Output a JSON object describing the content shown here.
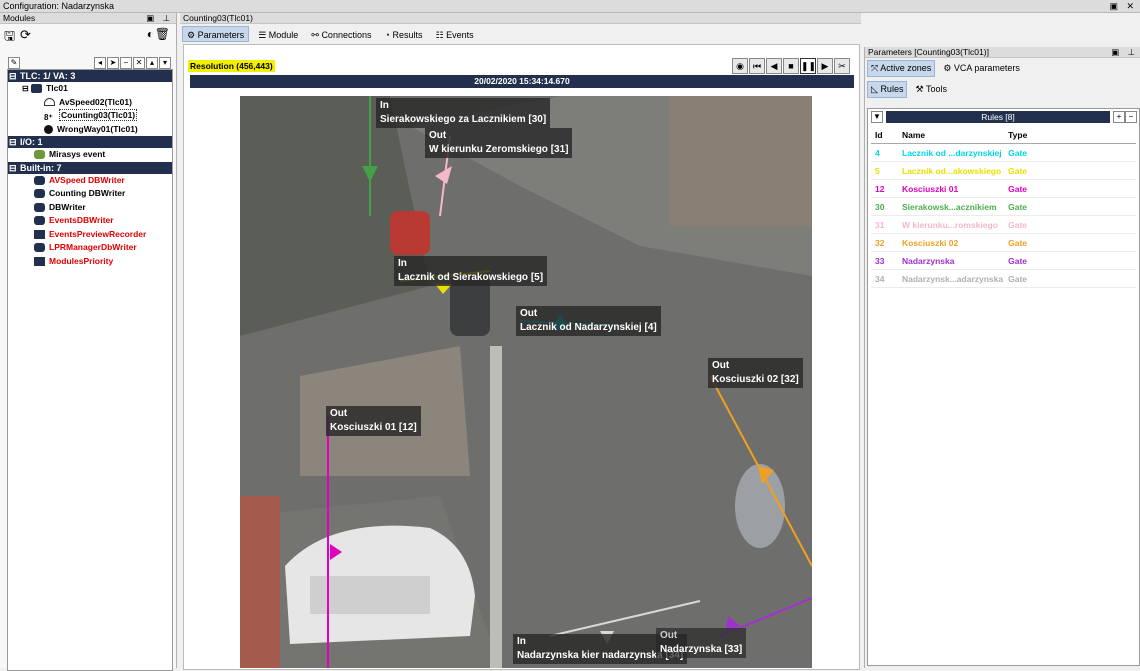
{
  "window": {
    "title": "Configuration: Nadarzynska"
  },
  "left": {
    "title": "Modules",
    "sections": [
      {
        "label": "TLC: 1/ VA: 3"
      },
      {
        "label": "I/O: 1"
      },
      {
        "label": "Built-in: 7"
      }
    ],
    "tlc": {
      "label": "Tlc01",
      "modules": [
        "AvSpeed02(Tlc01)",
        "Counting03(Tlc01)",
        "WrongWay01(Tlc01)"
      ]
    },
    "io": [
      "Mirasys event"
    ],
    "builtin": [
      "AVSpeed DBWriter",
      "Counting DBWriter",
      "DBWriter",
      "EventsDBWriter",
      "EventsPreviewRecorder",
      "LPRManagerDbWriter",
      "ModulesPriority"
    ]
  },
  "center": {
    "title": "Counting03(Tlc01)",
    "tabs": [
      "Parameters",
      "Module",
      "Connections",
      "Results",
      "Events"
    ],
    "resolution": "Resolution (456,443)",
    "timestamp": "20/02/2020 15:34:14.670",
    "overlays": [
      {
        "dir": "In",
        "name": "Sierakowskiego za Lacznikiem [30]"
      },
      {
        "dir": "Out",
        "name": "W kierunku Zeromskiego [31]"
      },
      {
        "dir": "In",
        "name": "Lacznik od Sierakowskiego [5]"
      },
      {
        "dir": "Out",
        "name": "Lacznik od Nadarzynskiej [4]"
      },
      {
        "dir": "Out",
        "name": "Kosciuszki 02 [32]"
      },
      {
        "dir": "Out",
        "name": "Kosciuszki 01 [12]"
      },
      {
        "dir": "In",
        "name": "Nadarzynska kier nadarzynska [34]"
      },
      {
        "dir": "Out",
        "name": "Nadarzynska [33]"
      }
    ]
  },
  "right": {
    "title": "Parameters [Counting03(Tlc01)]",
    "tabs": [
      "Active zones",
      "VCA parameters"
    ],
    "subtabs": [
      "Rules",
      "Tools"
    ],
    "rules_title": "Rules [8]",
    "columns": [
      "Id",
      "Name",
      "Type"
    ],
    "rows": [
      {
        "id": "4",
        "name": "Lacznik od ...darzynskiej",
        "type": "Gate",
        "color": "#00d8e8"
      },
      {
        "id": "5",
        "name": "Lacznik od...akowskiego",
        "type": "Gate",
        "color": "#e8e000"
      },
      {
        "id": "12",
        "name": "Kosciuszki 01",
        "type": "Gate",
        "color": "#e000c0"
      },
      {
        "id": "30",
        "name": "Sierakowsk...acznikiem",
        "type": "Gate",
        "color": "#4caf50"
      },
      {
        "id": "31",
        "name": "W kierunku...romskiego",
        "type": "Gate",
        "color": "#f4b8c8"
      },
      {
        "id": "32",
        "name": "Kosciuszki 02",
        "type": "Gate",
        "color": "#f0a020"
      },
      {
        "id": "33",
        "name": "Nadarzynska",
        "type": "Gate",
        "color": "#a030d0"
      },
      {
        "id": "34",
        "name": "Nadarzynsk...adarzynska",
        "type": "Gate",
        "color": "#b0b0b0"
      }
    ]
  }
}
